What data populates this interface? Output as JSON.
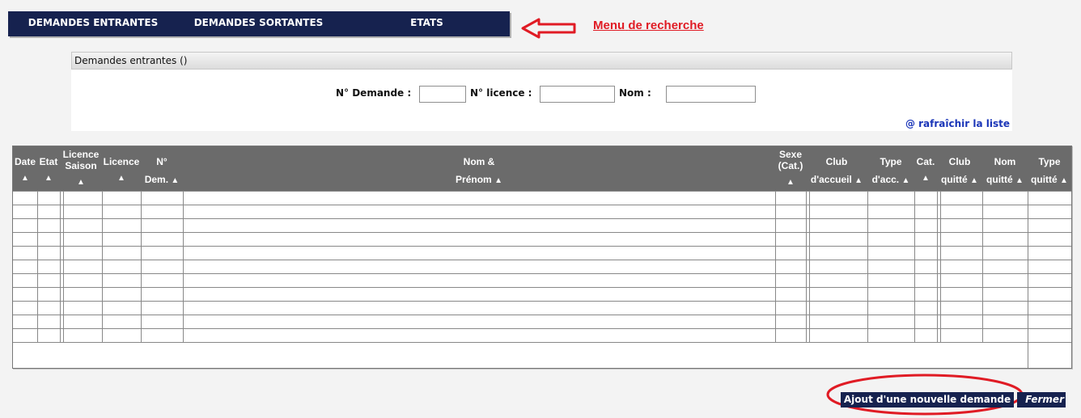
{
  "nav": {
    "items": [
      {
        "label": "DEMANDES ENTRANTES"
      },
      {
        "label": "DEMANDES SORTANTES"
      },
      {
        "label": "ETATS"
      }
    ],
    "bg_color": "#16224f"
  },
  "annotation": {
    "text_part1": "Menu",
    "text_part2": "de recherche",
    "color": "#e01b24"
  },
  "search_panel": {
    "title": "Demandes entrantes ()",
    "fields": [
      {
        "label": "N° Demande :",
        "value": ""
      },
      {
        "label": "N° licence :",
        "value": ""
      },
      {
        "label": "Nom :",
        "value": ""
      }
    ],
    "refresh_label": "@ rafraîchir la liste"
  },
  "table": {
    "sort_icon": "▲",
    "columns": [
      {
        "l1": "Date",
        "l2": ""
      },
      {
        "l1": "Etat",
        "l2": ""
      },
      {
        "l1": "Licence",
        "l1b": "Saison",
        "l2": ""
      },
      {
        "l1": "Licence",
        "l2": ""
      },
      {
        "l1": "N°",
        "l2": "Dem."
      },
      {
        "l1": "Nom &",
        "l2": "Prénom"
      },
      {
        "l1": "Sexe",
        "l1b": "(Cat.)",
        "l2": ""
      },
      {
        "l1": "Club",
        "l2": "d'accueil"
      },
      {
        "l1": "Type",
        "l2": "d'acc."
      },
      {
        "l1": "Cat.",
        "l2": ""
      },
      {
        "l1": "Club",
        "l2": "quitté"
      },
      {
        "l1": "Nom",
        "l2": "quitté"
      },
      {
        "l1": "Type",
        "l2": "quitté"
      }
    ],
    "rows": []
  },
  "buttons": {
    "add_label": "Ajout d'une nouvelle demande",
    "close_label": "Fermer"
  }
}
